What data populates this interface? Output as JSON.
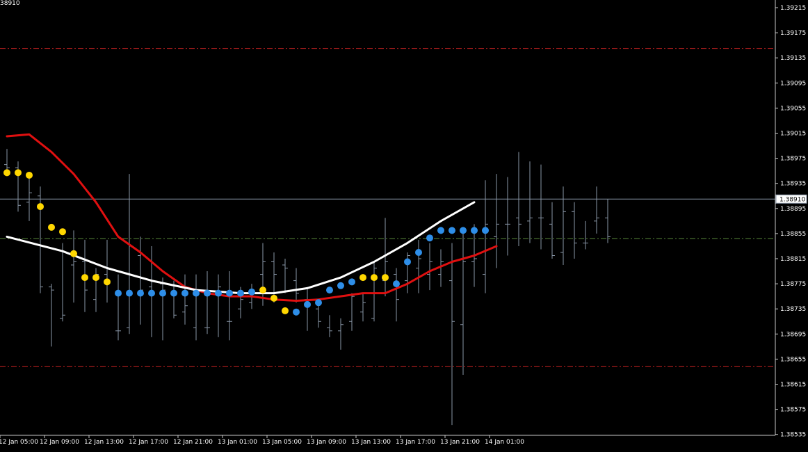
{
  "header": {
    "price_readout": "38910"
  },
  "chart_data": {
    "type": "line",
    "symbol_price_range": [
      1.3852,
      1.3923
    ],
    "y_ticks": [
      "1.39215",
      "1.39175",
      "1.39135",
      "1.39095",
      "1.39055",
      "1.39015",
      "1.38975",
      "1.38935",
      "1.38895",
      "1.38855",
      "1.38815",
      "1.38775",
      "1.38735",
      "1.38695",
      "1.38655",
      "1.38615",
      "1.38575",
      "1.38535"
    ],
    "x_ticks": [
      "12 Jan 05:00",
      "12 Jan 09:00",
      "12 Jan 13:00",
      "12 Jan 17:00",
      "12 Jan 21:00",
      "13 Jan 01:00",
      "13 Jan 05:00",
      "13 Jan 09:00",
      "13 Jan 13:00",
      "13 Jan 17:00",
      "13 Jan 21:00",
      "14 Jan 01:00"
    ],
    "current_price": "1.38910",
    "levels": [
      {
        "name": "upper-red-level",
        "value": 1.3915,
        "color": "#cc2222"
      },
      {
        "name": "green-level",
        "value": 1.38847,
        "color": "#5a8a3a"
      },
      {
        "name": "lower-red-level",
        "value": 1.38643,
        "color": "#cc2222"
      }
    ],
    "bars": [
      {
        "o": 1.38965,
        "h": 1.3899,
        "l": 1.38955,
        "c": 1.3896
      },
      {
        "o": 1.3896,
        "h": 1.3897,
        "l": 1.3889,
        "c": 1.389
      },
      {
        "o": 1.38905,
        "h": 1.38945,
        "l": 1.38875,
        "c": 1.3892
      },
      {
        "o": 1.38915,
        "h": 1.3893,
        "l": 1.3876,
        "c": 1.3877
      },
      {
        "o": 1.3877,
        "h": 1.38775,
        "l": 1.38675,
        "c": 1.38765
      },
      {
        "o": 1.3872,
        "h": 1.3884,
        "l": 1.38715,
        "c": 1.38725
      },
      {
        "o": 1.38805,
        "h": 1.3886,
        "l": 1.38745,
        "c": 1.3881
      },
      {
        "o": 1.3881,
        "h": 1.38845,
        "l": 1.3873,
        "c": 1.38765
      },
      {
        "o": 1.3875,
        "h": 1.388,
        "l": 1.3873,
        "c": 1.3879
      },
      {
        "o": 1.3879,
        "h": 1.38845,
        "l": 1.38745,
        "c": 1.3878
      },
      {
        "o": 1.387,
        "h": 1.3879,
        "l": 1.38685,
        "c": 1.387
      },
      {
        "o": 1.38705,
        "h": 1.3895,
        "l": 1.38695,
        "c": 1.38835
      },
      {
        "o": 1.3882,
        "h": 1.3885,
        "l": 1.3871,
        "c": 1.38765
      },
      {
        "o": 1.3877,
        "h": 1.38835,
        "l": 1.3869,
        "c": 1.3878
      },
      {
        "o": 1.38775,
        "h": 1.38785,
        "l": 1.38685,
        "c": 1.38765
      },
      {
        "o": 1.3876,
        "h": 1.3878,
        "l": 1.3872,
        "c": 1.38725
      },
      {
        "o": 1.3873,
        "h": 1.3879,
        "l": 1.3871,
        "c": 1.3874
      },
      {
        "o": 1.38705,
        "h": 1.3879,
        "l": 1.38685,
        "c": 1.3876
      },
      {
        "o": 1.38705,
        "h": 1.38795,
        "l": 1.38695,
        "c": 1.38705
      },
      {
        "o": 1.3876,
        "h": 1.3879,
        "l": 1.3869,
        "c": 1.3877
      },
      {
        "o": 1.38715,
        "h": 1.38795,
        "l": 1.38685,
        "c": 1.38715
      },
      {
        "o": 1.38735,
        "h": 1.3877,
        "l": 1.3872,
        "c": 1.3875
      },
      {
        "o": 1.38745,
        "h": 1.38775,
        "l": 1.38735,
        "c": 1.38765
      },
      {
        "o": 1.3879,
        "h": 1.3884,
        "l": 1.3874,
        "c": 1.3881
      },
      {
        "o": 1.3881,
        "h": 1.38825,
        "l": 1.38745,
        "c": 1.3879
      },
      {
        "o": 1.38805,
        "h": 1.38815,
        "l": 1.3876,
        "c": 1.388
      },
      {
        "o": 1.3878,
        "h": 1.388,
        "l": 1.38745,
        "c": 1.3876
      },
      {
        "o": 1.3875,
        "h": 1.3877,
        "l": 1.387,
        "c": 1.3874
      },
      {
        "o": 1.38735,
        "h": 1.38745,
        "l": 1.38705,
        "c": 1.38715
      },
      {
        "o": 1.38705,
        "h": 1.38725,
        "l": 1.3869,
        "c": 1.387
      },
      {
        "o": 1.387,
        "h": 1.3872,
        "l": 1.3867,
        "c": 1.3871
      },
      {
        "o": 1.38715,
        "h": 1.3876,
        "l": 1.387,
        "c": 1.38755
      },
      {
        "o": 1.3873,
        "h": 1.3876,
        "l": 1.38715,
        "c": 1.38745
      },
      {
        "o": 1.3872,
        "h": 1.3881,
        "l": 1.38715,
        "c": 1.388
      },
      {
        "o": 1.3878,
        "h": 1.3888,
        "l": 1.38755,
        "c": 1.3881
      },
      {
        "o": 1.3879,
        "h": 1.388,
        "l": 1.38715,
        "c": 1.3875
      },
      {
        "o": 1.3878,
        "h": 1.38825,
        "l": 1.3876,
        "c": 1.3882
      },
      {
        "o": 1.388,
        "h": 1.38845,
        "l": 1.3876,
        "c": 1.38815
      },
      {
        "o": 1.3879,
        "h": 1.3884,
        "l": 1.38765,
        "c": 1.3881
      },
      {
        "o": 1.3879,
        "h": 1.3883,
        "l": 1.3877,
        "c": 1.3881
      },
      {
        "o": 1.3878,
        "h": 1.3884,
        "l": 1.3855,
        "c": 1.38715
      },
      {
        "o": 1.3871,
        "h": 1.38865,
        "l": 1.3863,
        "c": 1.3881
      },
      {
        "o": 1.3881,
        "h": 1.3887,
        "l": 1.3877,
        "c": 1.38815
      },
      {
        "o": 1.3879,
        "h": 1.3894,
        "l": 1.3876,
        "c": 1.3887
      },
      {
        "o": 1.3885,
        "h": 1.3895,
        "l": 1.388,
        "c": 1.3887
      },
      {
        "o": 1.3887,
        "h": 1.38945,
        "l": 1.3882,
        "c": 1.3887
      },
      {
        "o": 1.3888,
        "h": 1.38985,
        "l": 1.38835,
        "c": 1.3887
      },
      {
        "o": 1.38875,
        "h": 1.3897,
        "l": 1.3884,
        "c": 1.3888
      },
      {
        "o": 1.3888,
        "h": 1.38965,
        "l": 1.3883,
        "c": 1.3888
      },
      {
        "o": 1.3887,
        "h": 1.38905,
        "l": 1.38815,
        "c": 1.3882
      },
      {
        "o": 1.38825,
        "h": 1.3893,
        "l": 1.38805,
        "c": 1.3889
      },
      {
        "o": 1.3889,
        "h": 1.38905,
        "l": 1.38815,
        "c": 1.3884
      },
      {
        "o": 1.3884,
        "h": 1.38875,
        "l": 1.3883,
        "c": 1.3884
      },
      {
        "o": 1.38875,
        "h": 1.3893,
        "l": 1.38855,
        "c": 1.3888
      },
      {
        "o": 1.3888,
        "h": 1.3891,
        "l": 1.3884,
        "c": 1.3885
      }
    ],
    "sar_dots": [
      {
        "i": 0,
        "v": 1.38952,
        "color": "#ffd700"
      },
      {
        "i": 1,
        "v": 1.38952,
        "color": "#ffd700"
      },
      {
        "i": 2,
        "v": 1.38948,
        "color": "#ffd700"
      },
      {
        "i": 3,
        "v": 1.38898,
        "color": "#ffd700"
      },
      {
        "i": 4,
        "v": 1.38865,
        "color": "#ffd700"
      },
      {
        "i": 5,
        "v": 1.38858,
        "color": "#ffd700"
      },
      {
        "i": 6,
        "v": 1.38823,
        "color": "#ffd700"
      },
      {
        "i": 7,
        "v": 1.38785,
        "color": "#ffd700"
      },
      {
        "i": 8,
        "v": 1.38785,
        "color": "#ffd700"
      },
      {
        "i": 9,
        "v": 1.38778,
        "color": "#ffd700"
      },
      {
        "i": 10,
        "v": 1.3876,
        "color": "#2e8ee8"
      },
      {
        "i": 11,
        "v": 1.3876,
        "color": "#2e8ee8"
      },
      {
        "i": 12,
        "v": 1.3876,
        "color": "#2e8ee8"
      },
      {
        "i": 13,
        "v": 1.3876,
        "color": "#2e8ee8"
      },
      {
        "i": 14,
        "v": 1.3876,
        "color": "#2e8ee8"
      },
      {
        "i": 15,
        "v": 1.3876,
        "color": "#2e8ee8"
      },
      {
        "i": 16,
        "v": 1.3876,
        "color": "#2e8ee8"
      },
      {
        "i": 17,
        "v": 1.3876,
        "color": "#2e8ee8"
      },
      {
        "i": 18,
        "v": 1.3876,
        "color": "#2e8ee8"
      },
      {
        "i": 19,
        "v": 1.3876,
        "color": "#2e8ee8"
      },
      {
        "i": 20,
        "v": 1.3876,
        "color": "#2e8ee8"
      },
      {
        "i": 21,
        "v": 1.3876,
        "color": "#2e8ee8"
      },
      {
        "i": 22,
        "v": 1.38762,
        "color": "#2e8ee8"
      },
      {
        "i": 23,
        "v": 1.38765,
        "color": "#ffd700"
      },
      {
        "i": 24,
        "v": 1.38752,
        "color": "#ffd700"
      },
      {
        "i": 25,
        "v": 1.38732,
        "color": "#ffd700"
      },
      {
        "i": 26,
        "v": 1.3873,
        "color": "#2e8ee8"
      },
      {
        "i": 27,
        "v": 1.38742,
        "color": "#2e8ee8"
      },
      {
        "i": 28,
        "v": 1.38745,
        "color": "#2e8ee8"
      },
      {
        "i": 29,
        "v": 1.38765,
        "color": "#2e8ee8"
      },
      {
        "i": 30,
        "v": 1.38772,
        "color": "#2e8ee8"
      },
      {
        "i": 31,
        "v": 1.38778,
        "color": "#2e8ee8"
      },
      {
        "i": 32,
        "v": 1.38785,
        "color": "#ffd700"
      },
      {
        "i": 33,
        "v": 1.38785,
        "color": "#ffd700"
      },
      {
        "i": 34,
        "v": 1.38785,
        "color": "#ffd700"
      },
      {
        "i": 35,
        "v": 1.38775,
        "color": "#2e8ee8"
      },
      {
        "i": 36,
        "v": 1.3881,
        "color": "#2e8ee8"
      },
      {
        "i": 37,
        "v": 1.38825,
        "color": "#2e8ee8"
      },
      {
        "i": 38,
        "v": 1.38848,
        "color": "#2e8ee8"
      },
      {
        "i": 39,
        "v": 1.3886,
        "color": "#2e8ee8"
      },
      {
        "i": 40,
        "v": 1.3886,
        "color": "#2e8ee8"
      },
      {
        "i": 41,
        "v": 1.3886,
        "color": "#2e8ee8"
      },
      {
        "i": 42,
        "v": 1.3886,
        "color": "#2e8ee8"
      },
      {
        "i": 43,
        "v": 1.3886,
        "color": "#2e8ee8"
      }
    ],
    "white_ma": [
      [
        0,
        1.3885
      ],
      [
        5,
        1.38827
      ],
      [
        9,
        1.388
      ],
      [
        13,
        1.3878
      ],
      [
        17,
        1.38765
      ],
      [
        21,
        1.3876
      ],
      [
        24,
        1.3876
      ],
      [
        27,
        1.38768
      ],
      [
        30,
        1.38785
      ],
      [
        33,
        1.3881
      ],
      [
        36,
        1.3884
      ],
      [
        39,
        1.38875
      ],
      [
        42,
        1.38905
      ]
    ],
    "red_ma": [
      [
        0,
        1.3901
      ],
      [
        2,
        1.39013
      ],
      [
        4,
        1.38985
      ],
      [
        6,
        1.3895
      ],
      [
        8,
        1.38905
      ],
      [
        10,
        1.3885
      ],
      [
        12,
        1.38825
      ],
      [
        14,
        1.38795
      ],
      [
        16,
        1.3877
      ],
      [
        18,
        1.3876
      ],
      [
        20,
        1.38755
      ],
      [
        22,
        1.38755
      ],
      [
        24,
        1.3875
      ],
      [
        26,
        1.38748
      ],
      [
        28,
        1.3875
      ],
      [
        30,
        1.38755
      ],
      [
        32,
        1.3876
      ],
      [
        34,
        1.3876
      ],
      [
        36,
        1.38775
      ],
      [
        38,
        1.38795
      ],
      [
        40,
        1.3881
      ],
      [
        42,
        1.3882
      ],
      [
        44,
        1.38835
      ]
    ]
  }
}
